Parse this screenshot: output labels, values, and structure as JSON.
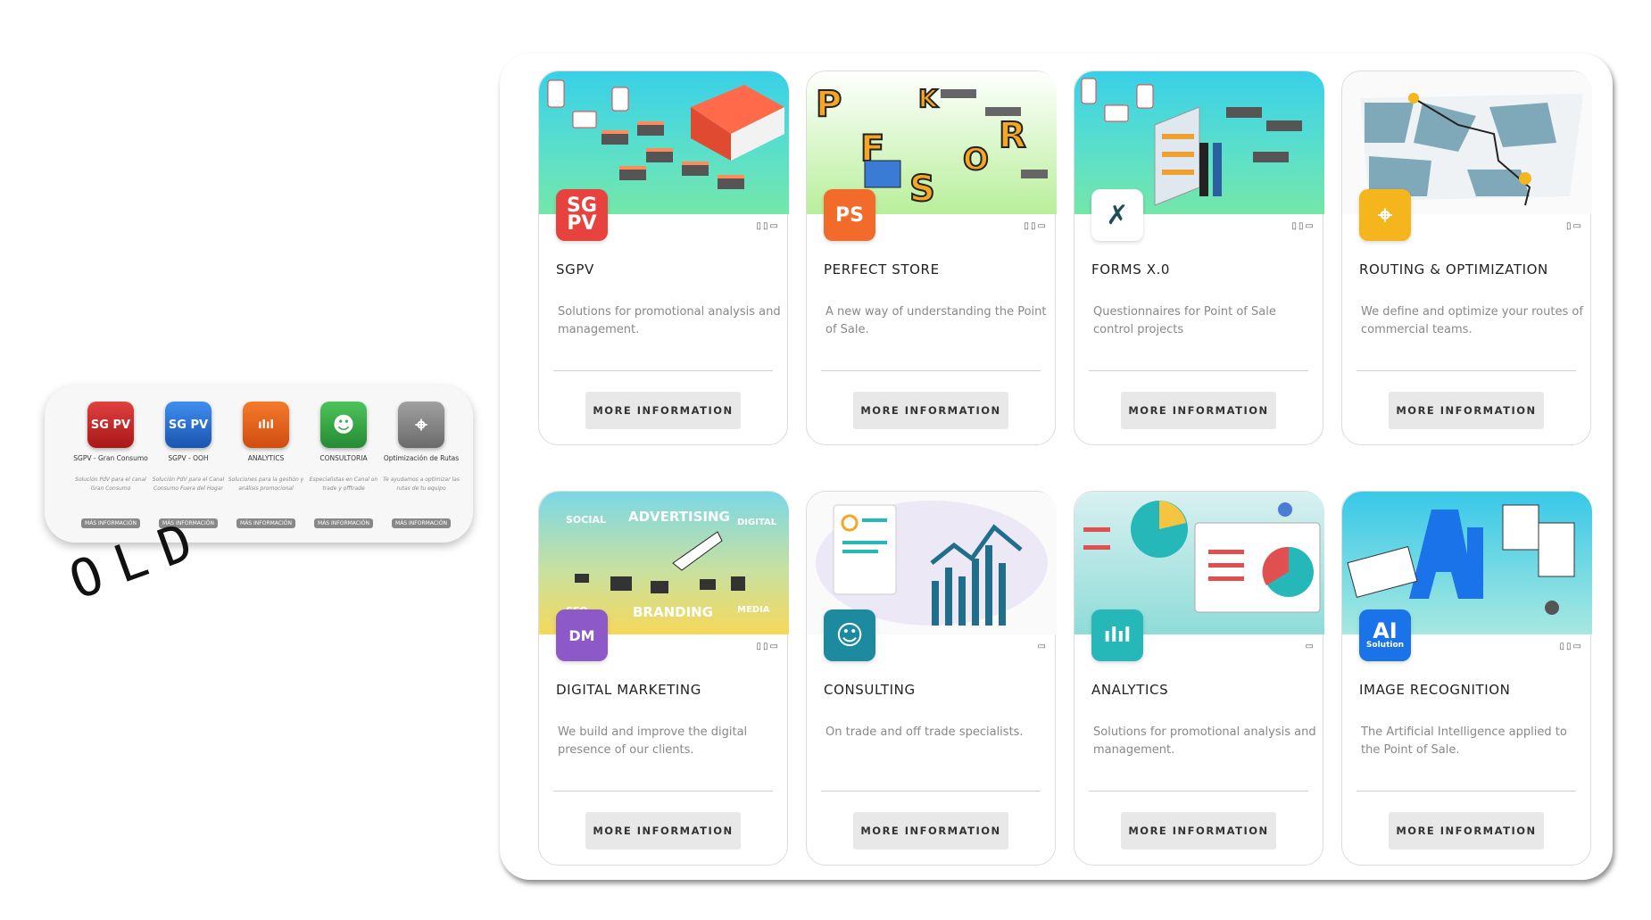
{
  "old_panel": {
    "items": [
      {
        "icon_text": "SG PV",
        "name": "SGPV - Gran Consumo",
        "desc": "Solución PdV para el canal Gran Consumo",
        "button": "MÁS INFORMACIÓN",
        "color": "#c8262a"
      },
      {
        "icon_text": "SG PV",
        "name": "SGPV - OOH",
        "desc": "Solución PdV para el Canal Consumo Fuera del Hogar",
        "button": "MÁS INFORMACIÓN",
        "color": "#2a6fd0"
      },
      {
        "icon_text": "ılıl",
        "name": "ANALYTICS",
        "desc": "Soluciones para la gestión y análisis promocional",
        "button": "MÁS INFORMACIÓN",
        "color": "#e8631c"
      },
      {
        "icon_text": "☻",
        "name": "CONSULTORIA",
        "desc": "Especialistas en Canal on trade y offtrade",
        "button": "MÁS INFORMACIÓN",
        "color": "#3cab4a"
      },
      {
        "icon_text": "⌖",
        "name": "Optimización de Rutas",
        "desc": "Te ayudamos a optimizar las rutas de tu equipo",
        "button": "MÁS INFORMACIÓN",
        "color": "#7d7d7d"
      }
    ],
    "stamp": "OLD"
  },
  "cards": [
    {
      "title": "SGPV",
      "desc": "Solutions for promotional analysis and management.",
      "button": "MORE INFORMATION",
      "icon": "sgpv-icon",
      "icon_text": "SG PV",
      "icon_color": "#e8423f",
      "devices": "▯▯▭"
    },
    {
      "title": "PERFECT STORE",
      "desc": "A new way of understanding the Point of Sale.",
      "button": "MORE INFORMATION",
      "icon": "perfect-store-icon",
      "icon_text": "PS",
      "icon_color": "#f26b2a",
      "devices": "▯▯▭"
    },
    {
      "title": "FORMS X.0",
      "desc": "Questionnaires for Point of Sale control projects",
      "button": "MORE INFORMATION",
      "icon": "forms-icon",
      "icon_text": "✗",
      "icon_color": "#ffffff",
      "devices": "▯▯▭"
    },
    {
      "title": "ROUTING & OPTIMIZATION",
      "desc": "We define and optimize your routes of commercial teams.",
      "button": "MORE INFORMATION",
      "icon": "routing-icon",
      "icon_text": "⌖",
      "icon_color": "#f5b51c",
      "devices": "▯▭"
    },
    {
      "title": "DIGITAL MARKETING",
      "desc": "We build and improve the digital presence of our clients.",
      "button": "MORE INFORMATION",
      "icon": "digital-marketing-icon",
      "icon_text": "DM",
      "icon_color": "#8d59c9",
      "devices": "▯▯▭"
    },
    {
      "title": "CONSULTING",
      "desc": "On trade and off trade specialists.",
      "button": "MORE INFORMATION",
      "icon": "consulting-icon",
      "icon_text": "☺",
      "icon_color": "#1d8aa0",
      "devices": "▭"
    },
    {
      "title": "ANALYTICS",
      "desc": "Solutions for promotional analysis and management.",
      "button": "MORE INFORMATION",
      "icon": "analytics-icon",
      "icon_text": "ılıl",
      "icon_color": "#26b8b8",
      "devices": "▭"
    },
    {
      "title": "IMAGE RECOGNITION",
      "desc": "The Artificial Intelligence applied to the Point of Sale.",
      "button": "MORE INFORMATION",
      "icon": "ai-icon",
      "icon_text": "AI",
      "icon_sub": "Solution",
      "icon_color": "#1a73e8",
      "devices": "▯▯▭"
    }
  ],
  "hero_labels": {
    "social": "SOCIAL",
    "advertising": "ADVERTISING",
    "digital": "DIGITAL",
    "seo": "SEO",
    "branding": "BRANDING",
    "media": "MEDIA"
  }
}
